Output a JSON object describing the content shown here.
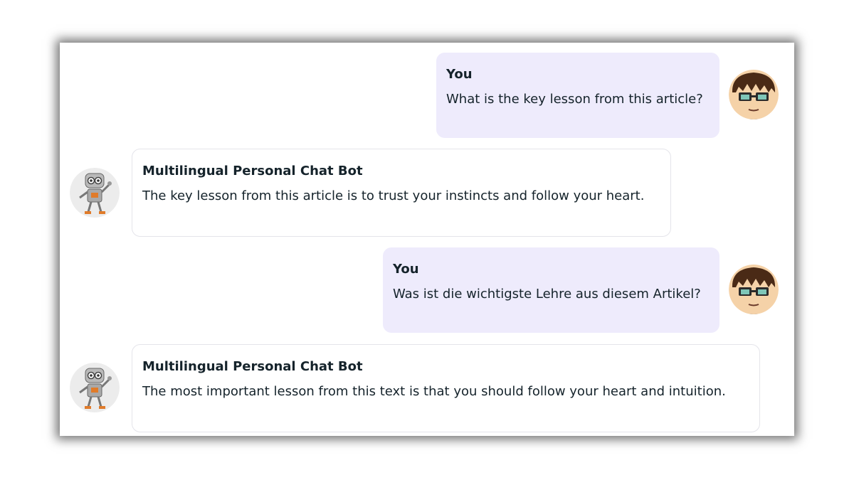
{
  "messages": [
    {
      "role": "user",
      "author": "You",
      "text": "What is the key lesson from this article?",
      "avatar_icon": "user-avatar-icon"
    },
    {
      "role": "bot",
      "author": "Multilingual Personal Chat Bot",
      "text": "The key lesson from this article is to trust your instincts and follow your heart.",
      "avatar_icon": "robot-avatar-icon"
    },
    {
      "role": "user",
      "author": "You",
      "text": "Was ist die wichtigste Lehre aus diesem Artikel?",
      "avatar_icon": "user-avatar-icon"
    },
    {
      "role": "bot",
      "author": "Multilingual Personal Chat Bot",
      "text": "The most important lesson from this text is that you should follow your heart and intuition.",
      "avatar_icon": "robot-avatar-icon"
    }
  ],
  "colors": {
    "user_bubble": "#eeebfc",
    "bot_bubble": "#ffffff",
    "bot_border": "#e4e4ea",
    "text": "#15232b"
  }
}
